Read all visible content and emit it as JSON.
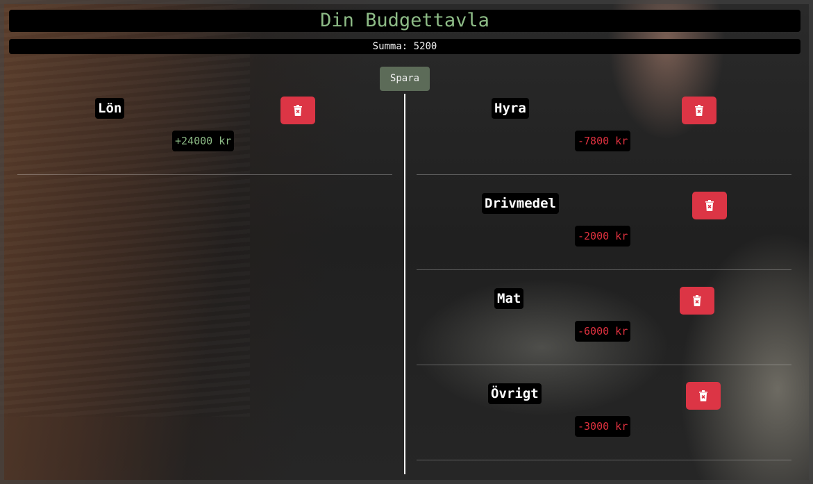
{
  "header": {
    "title": "Din Budgettavla",
    "sum_text": "Summa: 5200"
  },
  "toolbar": {
    "save_label": "Spara"
  },
  "colors": {
    "title": "#8dbb86",
    "income": "#8dbb86",
    "expense": "#e0313f",
    "delete_button": "#dc3545",
    "save_button": "#5c6b58"
  },
  "income": [
    {
      "name": "Lön",
      "amount": "+24000 kr",
      "delete_icon": "trash-x-icon"
    }
  ],
  "expenses": [
    {
      "name": "Hyra",
      "amount": "-7800 kr",
      "delete_icon": "trash-x-icon"
    },
    {
      "name": "Drivmedel",
      "amount": "-2000 kr",
      "delete_icon": "trash-x-icon"
    },
    {
      "name": "Mat",
      "amount": "-6000 kr",
      "delete_icon": "trash-x-icon"
    },
    {
      "name": "Övrigt",
      "amount": "-3000 kr",
      "delete_icon": "trash-x-icon"
    }
  ]
}
